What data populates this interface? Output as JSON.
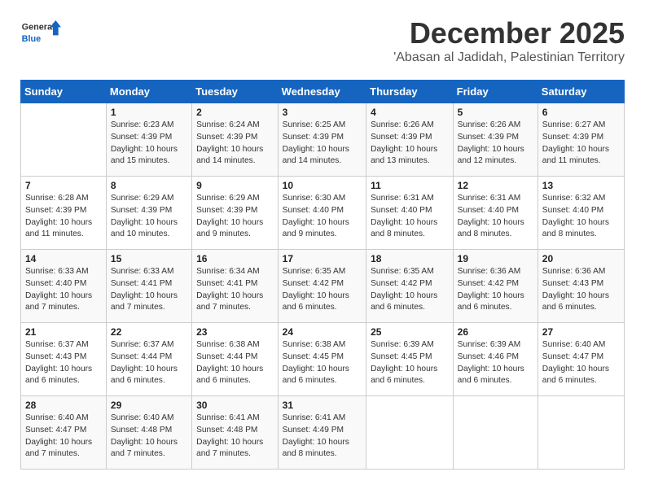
{
  "logo": {
    "line1": "General",
    "line2": "Blue"
  },
  "header": {
    "month": "December 2025",
    "location": "'Abasan al Jadidah, Palestinian Territory"
  },
  "weekdays": [
    "Sunday",
    "Monday",
    "Tuesday",
    "Wednesday",
    "Thursday",
    "Friday",
    "Saturday"
  ],
  "weeks": [
    [
      {
        "day": "",
        "sunrise": "",
        "sunset": "",
        "daylight": ""
      },
      {
        "day": "1",
        "sunrise": "Sunrise: 6:23 AM",
        "sunset": "Sunset: 4:39 PM",
        "daylight": "Daylight: 10 hours and 15 minutes."
      },
      {
        "day": "2",
        "sunrise": "Sunrise: 6:24 AM",
        "sunset": "Sunset: 4:39 PM",
        "daylight": "Daylight: 10 hours and 14 minutes."
      },
      {
        "day": "3",
        "sunrise": "Sunrise: 6:25 AM",
        "sunset": "Sunset: 4:39 PM",
        "daylight": "Daylight: 10 hours and 14 minutes."
      },
      {
        "day": "4",
        "sunrise": "Sunrise: 6:26 AM",
        "sunset": "Sunset: 4:39 PM",
        "daylight": "Daylight: 10 hours and 13 minutes."
      },
      {
        "day": "5",
        "sunrise": "Sunrise: 6:26 AM",
        "sunset": "Sunset: 4:39 PM",
        "daylight": "Daylight: 10 hours and 12 minutes."
      },
      {
        "day": "6",
        "sunrise": "Sunrise: 6:27 AM",
        "sunset": "Sunset: 4:39 PM",
        "daylight": "Daylight: 10 hours and 11 minutes."
      }
    ],
    [
      {
        "day": "7",
        "sunrise": "Sunrise: 6:28 AM",
        "sunset": "Sunset: 4:39 PM",
        "daylight": "Daylight: 10 hours and 11 minutes."
      },
      {
        "day": "8",
        "sunrise": "Sunrise: 6:29 AM",
        "sunset": "Sunset: 4:39 PM",
        "daylight": "Daylight: 10 hours and 10 minutes."
      },
      {
        "day": "9",
        "sunrise": "Sunrise: 6:29 AM",
        "sunset": "Sunset: 4:39 PM",
        "daylight": "Daylight: 10 hours and 9 minutes."
      },
      {
        "day": "10",
        "sunrise": "Sunrise: 6:30 AM",
        "sunset": "Sunset: 4:40 PM",
        "daylight": "Daylight: 10 hours and 9 minutes."
      },
      {
        "day": "11",
        "sunrise": "Sunrise: 6:31 AM",
        "sunset": "Sunset: 4:40 PM",
        "daylight": "Daylight: 10 hours and 8 minutes."
      },
      {
        "day": "12",
        "sunrise": "Sunrise: 6:31 AM",
        "sunset": "Sunset: 4:40 PM",
        "daylight": "Daylight: 10 hours and 8 minutes."
      },
      {
        "day": "13",
        "sunrise": "Sunrise: 6:32 AM",
        "sunset": "Sunset: 4:40 PM",
        "daylight": "Daylight: 10 hours and 8 minutes."
      }
    ],
    [
      {
        "day": "14",
        "sunrise": "Sunrise: 6:33 AM",
        "sunset": "Sunset: 4:40 PM",
        "daylight": "Daylight: 10 hours and 7 minutes."
      },
      {
        "day": "15",
        "sunrise": "Sunrise: 6:33 AM",
        "sunset": "Sunset: 4:41 PM",
        "daylight": "Daylight: 10 hours and 7 minutes."
      },
      {
        "day": "16",
        "sunrise": "Sunrise: 6:34 AM",
        "sunset": "Sunset: 4:41 PM",
        "daylight": "Daylight: 10 hours and 7 minutes."
      },
      {
        "day": "17",
        "sunrise": "Sunrise: 6:35 AM",
        "sunset": "Sunset: 4:42 PM",
        "daylight": "Daylight: 10 hours and 6 minutes."
      },
      {
        "day": "18",
        "sunrise": "Sunrise: 6:35 AM",
        "sunset": "Sunset: 4:42 PM",
        "daylight": "Daylight: 10 hours and 6 minutes."
      },
      {
        "day": "19",
        "sunrise": "Sunrise: 6:36 AM",
        "sunset": "Sunset: 4:42 PM",
        "daylight": "Daylight: 10 hours and 6 minutes."
      },
      {
        "day": "20",
        "sunrise": "Sunrise: 6:36 AM",
        "sunset": "Sunset: 4:43 PM",
        "daylight": "Daylight: 10 hours and 6 minutes."
      }
    ],
    [
      {
        "day": "21",
        "sunrise": "Sunrise: 6:37 AM",
        "sunset": "Sunset: 4:43 PM",
        "daylight": "Daylight: 10 hours and 6 minutes."
      },
      {
        "day": "22",
        "sunrise": "Sunrise: 6:37 AM",
        "sunset": "Sunset: 4:44 PM",
        "daylight": "Daylight: 10 hours and 6 minutes."
      },
      {
        "day": "23",
        "sunrise": "Sunrise: 6:38 AM",
        "sunset": "Sunset: 4:44 PM",
        "daylight": "Daylight: 10 hours and 6 minutes."
      },
      {
        "day": "24",
        "sunrise": "Sunrise: 6:38 AM",
        "sunset": "Sunset: 4:45 PM",
        "daylight": "Daylight: 10 hours and 6 minutes."
      },
      {
        "day": "25",
        "sunrise": "Sunrise: 6:39 AM",
        "sunset": "Sunset: 4:45 PM",
        "daylight": "Daylight: 10 hours and 6 minutes."
      },
      {
        "day": "26",
        "sunrise": "Sunrise: 6:39 AM",
        "sunset": "Sunset: 4:46 PM",
        "daylight": "Daylight: 10 hours and 6 minutes."
      },
      {
        "day": "27",
        "sunrise": "Sunrise: 6:40 AM",
        "sunset": "Sunset: 4:47 PM",
        "daylight": "Daylight: 10 hours and 6 minutes."
      }
    ],
    [
      {
        "day": "28",
        "sunrise": "Sunrise: 6:40 AM",
        "sunset": "Sunset: 4:47 PM",
        "daylight": "Daylight: 10 hours and 7 minutes."
      },
      {
        "day": "29",
        "sunrise": "Sunrise: 6:40 AM",
        "sunset": "Sunset: 4:48 PM",
        "daylight": "Daylight: 10 hours and 7 minutes."
      },
      {
        "day": "30",
        "sunrise": "Sunrise: 6:41 AM",
        "sunset": "Sunset: 4:48 PM",
        "daylight": "Daylight: 10 hours and 7 minutes."
      },
      {
        "day": "31",
        "sunrise": "Sunrise: 6:41 AM",
        "sunset": "Sunset: 4:49 PM",
        "daylight": "Daylight: 10 hours and 8 minutes."
      },
      {
        "day": "",
        "sunrise": "",
        "sunset": "",
        "daylight": ""
      },
      {
        "day": "",
        "sunrise": "",
        "sunset": "",
        "daylight": ""
      },
      {
        "day": "",
        "sunrise": "",
        "sunset": "",
        "daylight": ""
      }
    ]
  ]
}
